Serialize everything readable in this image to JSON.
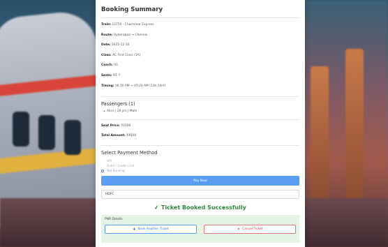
{
  "booking": {
    "title": "Booking Summary",
    "details": [
      {
        "label": "Train:",
        "value": "12759 - Charminar Express"
      },
      {
        "label": "Route:",
        "value": "Hyderabad → Chennai"
      },
      {
        "label": "Date:",
        "value": "2025-12-30"
      },
      {
        "label": "Class:",
        "value": "AC First Class (1A)"
      },
      {
        "label": "Coach:",
        "value": "H1"
      },
      {
        "label": "Seats:",
        "value": "H1-7"
      },
      {
        "label": "Timing:",
        "value": "06:10 PM → 07:20 AM (13h 10m)"
      }
    ]
  },
  "passengers": {
    "title": "Passengers (1)",
    "items": [
      "Alice | 20 yrs | Male"
    ]
  },
  "pricing": {
    "seat_label": "Seat Price:",
    "seat_value": "₹4500",
    "total_label": "Total Amount:",
    "total_value": "₹4500"
  },
  "payment": {
    "title": "Select Payment Method",
    "options": [
      "UPI",
      "Debit / Credit Card",
      "Net Banking"
    ],
    "selected": "Net Banking",
    "pay_button": "Pay Now",
    "bank_value": "HDFC"
  },
  "result": {
    "success_text": "Ticket Booked Successfully",
    "pnr_label": "PNR Details",
    "book_another": "Book Another Ticket",
    "cancel": "Cancel Ticket"
  },
  "colors": {
    "primary": "#5b9df0",
    "success": "#2e8a3f",
    "danger": "#d03a3a"
  }
}
